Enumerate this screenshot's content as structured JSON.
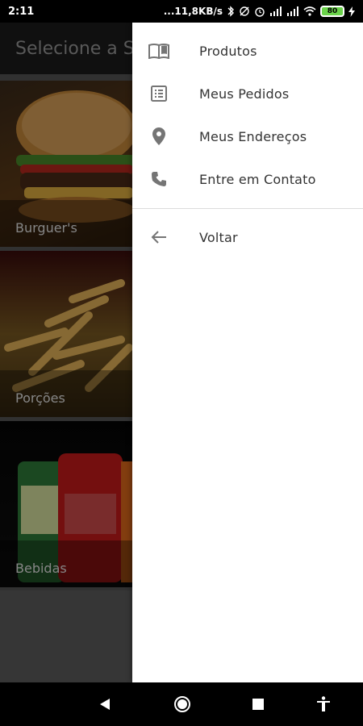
{
  "status_bar": {
    "time": "2:11",
    "network_speed": "...11,8KB/s",
    "battery_level": "80"
  },
  "app_bar": {
    "title": "Selecione a S"
  },
  "categories": [
    {
      "label": "Burguer's"
    },
    {
      "label": "Porções"
    },
    {
      "label": "Bebidas"
    }
  ],
  "drawer": {
    "items": [
      {
        "label": "Produtos",
        "icon": "book-open-icon"
      },
      {
        "label": "Meus Pedidos",
        "icon": "list-icon"
      },
      {
        "label": "Meus Endereços",
        "icon": "location-pin-icon"
      },
      {
        "label": "Entre em Contato",
        "icon": "phone-icon"
      }
    ],
    "back": {
      "label": "Voltar",
      "icon": "arrow-back-icon"
    }
  },
  "colors": {
    "drawer_bg": "#ffffff",
    "icon": "#757575",
    "battery": "#6ad24a"
  }
}
